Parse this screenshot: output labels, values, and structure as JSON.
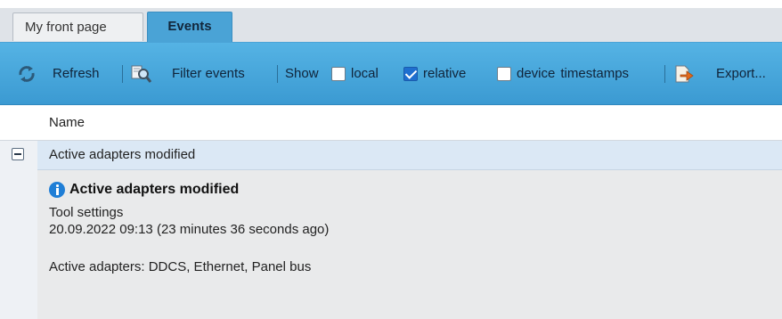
{
  "tabs": {
    "front_label": "My front page",
    "events_label": "Events"
  },
  "toolbar": {
    "refresh_label": "Refresh",
    "filter_label": "Filter events",
    "show_label": "Show",
    "local_label": "local",
    "local_checked": false,
    "relative_label": "relative",
    "relative_checked": true,
    "device_label": "device",
    "timestamps_label": "timestamps",
    "export_label": "Export..."
  },
  "table": {
    "name_header": "Name"
  },
  "event_group": {
    "label": "Active adapters modified",
    "expanded": true
  },
  "event_detail": {
    "title": "Active adapters modified",
    "source": "Tool settings",
    "timestamp": "20.09.2022 09:13 (23 minutes 36 seconds ago)",
    "message": "Active adapters: DDCS, Ethernet, Panel bus"
  },
  "colors": {
    "accent": "#4aa3d6",
    "toolbar_top": "#55b3e4",
    "toolbar_bottom": "#3b9ad2",
    "group_row": "#dbe8f5",
    "detail_bg": "#e9eaeb",
    "info_icon": "#1f7ed6",
    "checkbox_checked": "#1f6fcf"
  },
  "icons": {
    "refresh": "refresh-icon",
    "filter": "filter-magnifier-icon",
    "export": "export-icon",
    "info": "info-icon",
    "collapse": "collapse-minus-icon"
  }
}
